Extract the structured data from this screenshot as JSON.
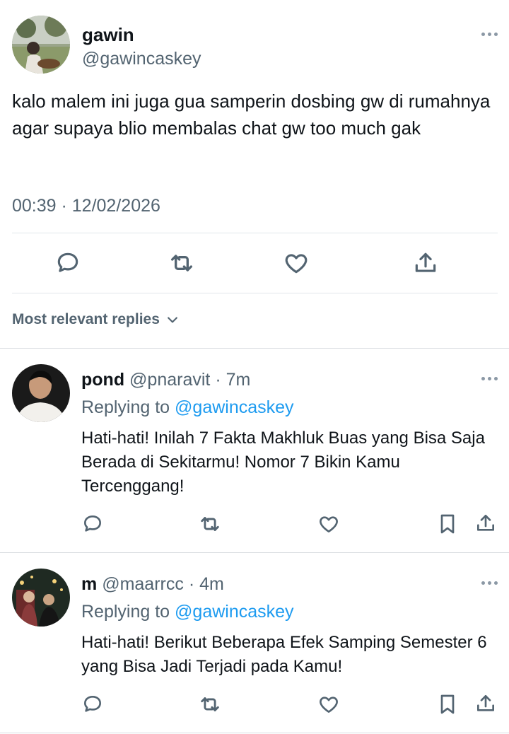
{
  "tweet": {
    "display_name": "gawin",
    "handle": "@gawincaskey",
    "text": "kalo malem ini juga gua samperin dosbing gw di rumahnya agar supaya blio membalas chat gw too much gak",
    "timestamp": "00:39 · 12/02/2026",
    "actions": [
      "reply-icon",
      "retweet-icon",
      "like-icon",
      "share-icon"
    ]
  },
  "sort": {
    "label": "Most relevant replies"
  },
  "replies": [
    {
      "display_name": "pond",
      "handle": "@pnaravit",
      "time": "· 7m",
      "replying_prefix": "Replying to",
      "replying_to": "@gawincaskey",
      "text": "Hati-hati! Inilah 7 Fakta Makhluk Buas yang Bisa Saja Berada di Sekitarmu! Nomor 7 Bikin Kamu Tercenggang!"
    },
    {
      "display_name": "m",
      "handle": "@maarrcc",
      "time": "· 4m",
      "replying_prefix": "Replying to",
      "replying_to": "@gawincaskey",
      "text": "Hati-hati! Berikut Beberapa Efek Samping Semester 6 yang Bisa Jadi Terjadi pada Kamu!"
    }
  ],
  "colors": {
    "text": "#0f1419",
    "secondary": "#536471",
    "mention": "#1d9bf0",
    "divider": "#e1e6ea"
  }
}
